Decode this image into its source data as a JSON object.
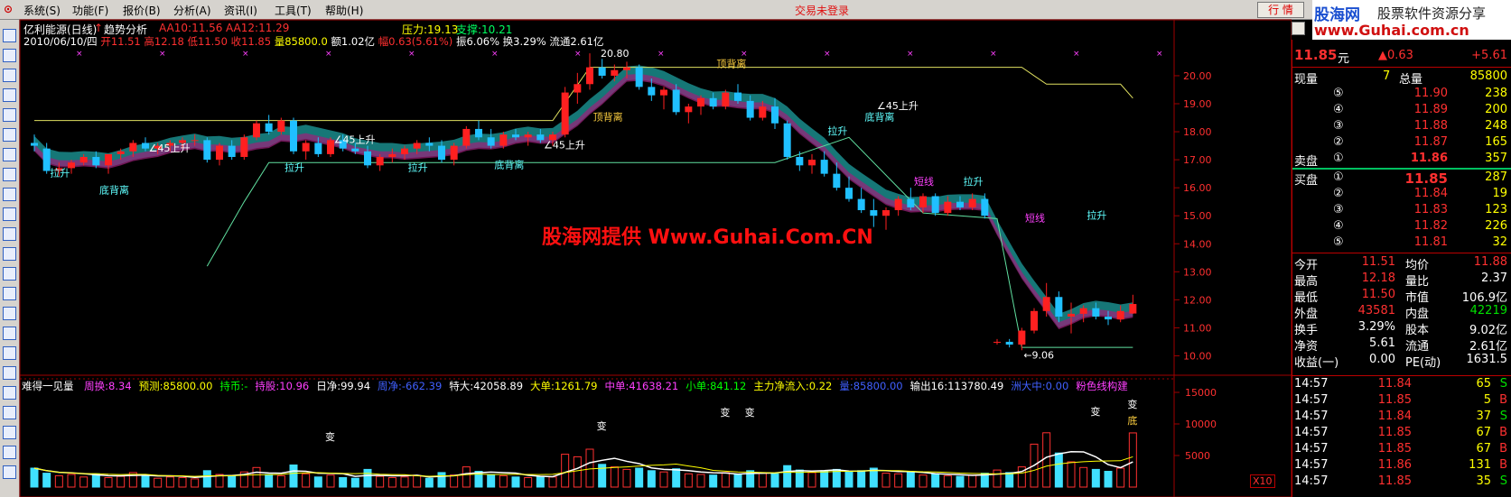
{
  "menu": {
    "items": [
      "系统(S)",
      "功能(F)",
      "报价(B)",
      "分析(A)",
      "资讯(I)",
      "工具(T)",
      "帮助(H)"
    ],
    "status": "交易未登录",
    "quote_button": "行 情"
  },
  "logo": {
    "brand": "股海网",
    "slogan": "股票软件资源分享",
    "url": "www.Guhai.com.cn"
  },
  "toolbar_icons": [
    "rise-icon",
    "fall-icon",
    "kline-icon",
    "trend-icon",
    "list-icon",
    "grid-icon",
    "table-icon",
    "market-icon",
    "news-icon",
    "stock-icon",
    "zhi-icon",
    "sort-icon",
    "etf-icon",
    "chart-icon",
    "rsi-icon",
    "cal-icon",
    "report-icon",
    "percent-icon",
    "tool-icon",
    "pen-icon",
    "up-icon",
    "move-icon",
    "down-icon"
  ],
  "main_chart": {
    "stock_name": "亿利能源(日线)",
    "indicator": "趋势分析",
    "ma1": "AA10:11.56",
    "ma2": "AA12:11.29",
    "pressure": "压力:19.13",
    "support": "支撑:10.21",
    "info": {
      "date": "2010/06/10/四",
      "open": "开11.51",
      "high": "高12.18",
      "low": "低11.50",
      "close": "收11.85",
      "volume": "量85800.0",
      "amount": "额1.02亿",
      "amplitude": "幅0.63(5.61%)",
      "swing": "振6.06%",
      "turnover": "换3.29%",
      "float": "流通2.61亿"
    },
    "price_ticks": [
      "20.00",
      "19.00",
      "18.00",
      "17.00",
      "16.00",
      "15.00",
      "14.00",
      "13.00",
      "12.00",
      "11.00",
      "10.00"
    ],
    "watermark": "股海网提供 Www.Guhai.Com.CN",
    "labels": {
      "lashen": "拉升",
      "dibeili": "底背离",
      "dingbeili": "顶背离",
      "up45": "∠45上升",
      "duanxian": "短线",
      "peak": "20.80",
      "trough": "←9.06"
    }
  },
  "volume_chart": {
    "indicator": "难得一见量",
    "items": [
      {
        "t": "周换:8.34",
        "c": "#ff40ff"
      },
      {
        "t": "预测:85800.00",
        "c": "#ffff00"
      },
      {
        "t": "持币:-",
        "c": "#00ff00"
      },
      {
        "t": "持股:10.96",
        "c": "#ff40ff"
      },
      {
        "t": "日净:99.94",
        "c": "#ffffff"
      },
      {
        "t": "周净:-662.39",
        "c": "#4060ff"
      },
      {
        "t": "特大:42058.89",
        "c": "#ffffff"
      },
      {
        "t": "大单:1261.79",
        "c": "#ffff00"
      },
      {
        "t": "中单:41638.21",
        "c": "#ff40ff"
      },
      {
        "t": "小单:841.12",
        "c": "#00ff00"
      },
      {
        "t": "主力净流入:0.22",
        "c": "#ffff00"
      },
      {
        "t": "量:85800.00",
        "c": "#4060ff"
      },
      {
        "t": "输出16:113780.49",
        "c": "#ffffff"
      },
      {
        "t": "洲大中:0.00",
        "c": "#4060ff"
      },
      {
        "t": "粉色线构建",
        "c": "#ff40ff"
      }
    ],
    "ticks": [
      "15000",
      "10000",
      "5000"
    ],
    "multiplier": "X10",
    "bian": "变",
    "di": "底"
  },
  "right_panel": {
    "price": "11.85",
    "price_unit": "元",
    "change": "▲0.63",
    "change_pct": "+5.61",
    "xianliang_label": "现量",
    "xianliang": "7",
    "zongliang_label": "总量",
    "zongliang": "85800",
    "sell": [
      {
        "n": "⑤",
        "p": "11.90",
        "v": "238"
      },
      {
        "n": "④",
        "p": "11.89",
        "v": "200"
      },
      {
        "n": "③",
        "p": "11.88",
        "v": "248"
      },
      {
        "n": "②",
        "p": "11.87",
        "v": "165"
      },
      {
        "n": "①",
        "p": "11.86",
        "v": "357"
      }
    ],
    "buy": [
      {
        "n": "①",
        "p": "11.85",
        "v": "287"
      },
      {
        "n": "②",
        "p": "11.84",
        "v": "19"
      },
      {
        "n": "③",
        "p": "11.83",
        "v": "123"
      },
      {
        "n": "④",
        "p": "11.82",
        "v": "226"
      },
      {
        "n": "⑤",
        "p": "11.81",
        "v": "32"
      }
    ],
    "sell_label": "卖盘",
    "buy_label": "买盘",
    "stats": [
      {
        "l": "今开",
        "v": "11.51",
        "l2": "均价",
        "v2": "11.88",
        "c": "#ff3030",
        "c2": "#ff3030"
      },
      {
        "l": "最高",
        "v": "12.18",
        "l2": "量比",
        "v2": "2.37",
        "c": "#ff3030",
        "c2": "#ffffff"
      },
      {
        "l": "最低",
        "v": "11.50",
        "l2": "市值",
        "v2": "106.9亿",
        "c": "#ff3030",
        "c2": "#ffffff"
      },
      {
        "l": "外盘",
        "v": "43581",
        "l2": "内盘",
        "v2": "42219",
        "c": "#ff3030",
        "c2": "#00e000"
      },
      {
        "l": "换手",
        "v": "3.29%",
        "l2": "股本",
        "v2": "9.02亿",
        "c": "#ffffff",
        "c2": "#ffffff"
      },
      {
        "l": "净资",
        "v": "5.61",
        "l2": "流通",
        "v2": "2.61亿",
        "c": "#ffffff",
        "c2": "#ffffff"
      },
      {
        "l": "收益(一)",
        "v": "0.00",
        "l2": "PE(动)",
        "v2": "1631.5",
        "c": "#ffffff",
        "c2": "#ffffff"
      }
    ],
    "ticks": [
      {
        "t": "14:57",
        "p": "11.84",
        "v": "65",
        "s": "S"
      },
      {
        "t": "14:57",
        "p": "11.85",
        "v": "5",
        "s": "B"
      },
      {
        "t": "14:57",
        "p": "11.84",
        "v": "37",
        "s": "S"
      },
      {
        "t": "14:57",
        "p": "11.85",
        "v": "67",
        "s": "B"
      },
      {
        "t": "14:57",
        "p": "11.85",
        "v": "67",
        "s": "B"
      },
      {
        "t": "14:57",
        "p": "11.86",
        "v": "131",
        "s": "B"
      },
      {
        "t": "14:57",
        "p": "11.85",
        "v": "35",
        "s": "S"
      }
    ]
  },
  "chart_data": {
    "type": "candlestick",
    "ylim": [
      9.5,
      20.9
    ],
    "candles": [
      [
        17.6,
        17.9,
        17.3,
        17.5
      ],
      [
        17.4,
        17.6,
        16.5,
        16.6
      ],
      [
        16.6,
        16.9,
        16.4,
        16.7
      ],
      [
        16.7,
        17.0,
        16.5,
        16.9
      ],
      [
        16.9,
        17.2,
        16.8,
        17.1
      ],
      [
        17.1,
        17.3,
        16.7,
        16.8
      ],
      [
        16.8,
        17.2,
        16.5,
        17.2
      ],
      [
        17.2,
        17.4,
        17.0,
        17.3
      ],
      [
        17.3,
        17.7,
        17.1,
        17.6
      ],
      [
        17.6,
        17.8,
        17.3,
        17.4
      ],
      [
        17.4,
        17.6,
        17.2,
        17.5
      ],
      [
        17.5,
        17.7,
        17.3,
        17.6
      ],
      [
        17.6,
        17.8,
        17.4,
        17.7
      ],
      [
        17.7,
        17.9,
        17.5,
        17.7
      ],
      [
        17.7,
        17.8,
        16.9,
        17.0
      ],
      [
        17.0,
        17.6,
        16.8,
        17.5
      ],
      [
        17.5,
        17.7,
        17.0,
        17.1
      ],
      [
        17.1,
        17.9,
        17.0,
        17.8
      ],
      [
        17.8,
        18.4,
        17.7,
        18.3
      ],
      [
        18.3,
        18.6,
        17.9,
        18.0
      ],
      [
        18.0,
        18.5,
        17.9,
        18.4
      ],
      [
        18.4,
        18.5,
        17.2,
        17.3
      ],
      [
        17.3,
        17.7,
        17.0,
        17.6
      ],
      [
        17.6,
        17.8,
        17.1,
        17.2
      ],
      [
        17.2,
        17.8,
        17.1,
        17.7
      ],
      [
        17.7,
        17.9,
        17.3,
        17.4
      ],
      [
        17.4,
        17.6,
        17.2,
        17.3
      ],
      [
        17.3,
        17.5,
        16.7,
        16.8
      ],
      [
        16.8,
        17.2,
        16.6,
        17.1
      ],
      [
        17.1,
        17.4,
        16.9,
        17.2
      ],
      [
        17.2,
        17.5,
        17.0,
        17.4
      ],
      [
        17.4,
        17.7,
        17.2,
        17.6
      ],
      [
        17.6,
        17.8,
        17.3,
        17.5
      ],
      [
        17.5,
        17.7,
        16.9,
        17.0
      ],
      [
        17.0,
        17.6,
        16.8,
        17.5
      ],
      [
        17.5,
        18.2,
        17.4,
        18.1
      ],
      [
        18.1,
        18.4,
        17.7,
        17.8
      ],
      [
        17.8,
        18.1,
        17.4,
        17.5
      ],
      [
        17.5,
        18.0,
        17.4,
        17.9
      ],
      [
        17.9,
        18.1,
        17.7,
        17.8
      ],
      [
        17.8,
        18.0,
        17.5,
        17.9
      ],
      [
        17.9,
        18.1,
        17.6,
        17.7
      ],
      [
        17.7,
        18.0,
        17.5,
        17.9
      ],
      [
        17.9,
        19.6,
        17.8,
        19.4
      ],
      [
        19.4,
        20.1,
        19.0,
        19.7
      ],
      [
        19.7,
        20.8,
        19.5,
        20.3
      ],
      [
        20.3,
        20.6,
        19.9,
        20.0
      ],
      [
        20.0,
        20.4,
        19.8,
        20.2
      ],
      [
        20.2,
        20.5,
        19.9,
        20.3
      ],
      [
        20.3,
        20.4,
        19.5,
        19.6
      ],
      [
        19.6,
        19.9,
        19.1,
        19.3
      ],
      [
        19.3,
        19.6,
        18.8,
        19.5
      ],
      [
        19.5,
        19.7,
        18.6,
        18.7
      ],
      [
        18.7,
        19.0,
        18.3,
        18.9
      ],
      [
        18.9,
        19.3,
        18.6,
        19.2
      ],
      [
        19.2,
        19.4,
        18.8,
        18.9
      ],
      [
        18.9,
        19.5,
        18.8,
        19.4
      ],
      [
        19.4,
        19.7,
        19.0,
        19.1
      ],
      [
        19.1,
        19.3,
        18.4,
        18.5
      ],
      [
        18.5,
        19.1,
        18.4,
        18.9
      ],
      [
        18.9,
        19.2,
        18.1,
        18.3
      ],
      [
        18.3,
        18.4,
        17.0,
        17.1
      ],
      [
        17.1,
        17.3,
        16.6,
        16.8
      ],
      [
        16.8,
        17.2,
        16.5,
        17.0
      ],
      [
        17.0,
        17.3,
        16.4,
        16.5
      ],
      [
        16.5,
        16.9,
        15.9,
        16.0
      ],
      [
        16.0,
        16.4,
        15.5,
        15.6
      ],
      [
        15.6,
        16.0,
        15.1,
        15.2
      ],
      [
        15.2,
        15.6,
        14.6,
        15.0
      ],
      [
        15.0,
        15.3,
        14.5,
        15.2
      ],
      [
        15.2,
        15.7,
        15.0,
        15.6
      ],
      [
        15.6,
        16.0,
        15.2,
        15.3
      ],
      [
        15.3,
        15.8,
        15.1,
        15.7
      ],
      [
        15.7,
        15.8,
        15.0,
        15.1
      ],
      [
        15.1,
        15.7,
        15.0,
        15.5
      ],
      [
        15.5,
        15.7,
        15.2,
        15.3
      ],
      [
        15.3,
        15.8,
        15.2,
        15.6
      ],
      [
        15.6,
        15.8,
        14.9,
        15.0
      ],
      [
        10.5,
        10.6,
        10.4,
        10.5
      ],
      [
        10.5,
        10.6,
        10.3,
        10.4
      ],
      [
        10.4,
        11.0,
        10.2,
        10.9
      ],
      [
        10.9,
        11.7,
        10.8,
        11.6
      ],
      [
        11.6,
        12.6,
        11.4,
        12.1
      ],
      [
        12.1,
        12.3,
        11.2,
        11.4
      ],
      [
        11.4,
        11.9,
        10.8,
        11.5
      ],
      [
        11.5,
        11.8,
        11.2,
        11.7
      ],
      [
        11.7,
        11.9,
        11.3,
        11.4
      ],
      [
        11.4,
        11.6,
        11.1,
        11.3
      ],
      [
        11.3,
        11.8,
        11.2,
        11.6
      ],
      [
        11.51,
        12.18,
        11.5,
        11.85
      ]
    ],
    "volumes": [
      3000,
      2200,
      1800,
      2000,
      1600,
      2100,
      1500,
      1700,
      2300,
      1900,
      1400,
      1600,
      1500,
      1300,
      2600,
      2000,
      1700,
      2400,
      3100,
      2000,
      1800,
      3500,
      2100,
      1600,
      1900,
      1500,
      1400,
      2800,
      1700,
      1500,
      1600,
      1800,
      1400,
      2300,
      1900,
      3200,
      2500,
      2000,
      1800,
      1600,
      1500,
      1700,
      1600,
      5200,
      4800,
      6000,
      3600,
      3200,
      2800,
      3000,
      2600,
      2400,
      2900,
      2100,
      2000,
      1900,
      2300,
      2000,
      2600,
      2200,
      2100,
      3400,
      2700,
      2300,
      2500,
      2800,
      2400,
      2600,
      3000,
      2200,
      2100,
      2400,
      1900,
      2000,
      1800,
      1700,
      1900,
      2200,
      2700,
      2300,
      3200,
      6800,
      8600,
      5400,
      4000,
      3100,
      2800,
      2500,
      3000,
      8580
    ],
    "vol_ylim": [
      0,
      16000
    ]
  }
}
